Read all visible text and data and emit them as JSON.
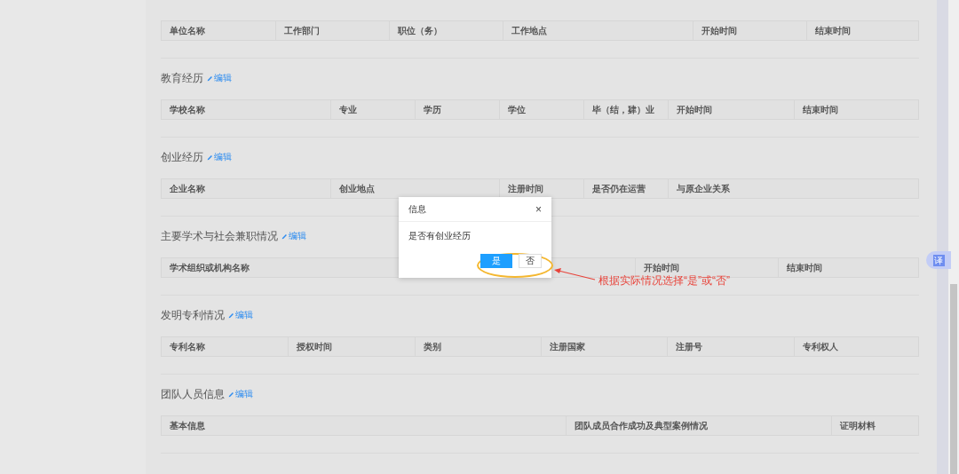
{
  "sections": [
    {
      "columns": [
        "单位名称",
        "工作部门",
        "职位（务）",
        "工作地点",
        "开始时间",
        "结束时间"
      ]
    },
    {
      "title": "教育经历",
      "edit": "编辑",
      "columns": [
        "学校名称",
        "专业",
        "学历",
        "学位",
        "毕（结，肄）业",
        "开始时间",
        "结束时间"
      ]
    },
    {
      "title": "创业经历",
      "edit": "编辑",
      "columns": [
        "企业名称",
        "创业地点",
        "注册时间",
        "是否仍在运营",
        "与原企业关系"
      ]
    },
    {
      "title": "主要学术与社会兼职情况",
      "edit": "编辑",
      "columns": [
        "学术组织或机构名称",
        "开始时间",
        "结束时间"
      ]
    },
    {
      "title": "发明专利情况",
      "edit": "编辑",
      "columns": [
        "专利名称",
        "授权时间",
        "类别",
        "注册国家",
        "注册号",
        "专利权人"
      ]
    },
    {
      "title": "团队人员信息",
      "edit": "编辑",
      "columns": [
        "基本信息",
        "团队成员合作成功及典型案例情况",
        "证明材料"
      ]
    }
  ],
  "dialog": {
    "title": "信息",
    "close": "×",
    "message": "是否有创业经历",
    "buttons": [
      {
        "label": "是",
        "kind": "primary"
      },
      {
        "label": "否",
        "kind": "default"
      }
    ]
  },
  "annotation": {
    "text": "根据实际情况选择“是”或“否”"
  },
  "translate_button": {
    "label": "译"
  }
}
